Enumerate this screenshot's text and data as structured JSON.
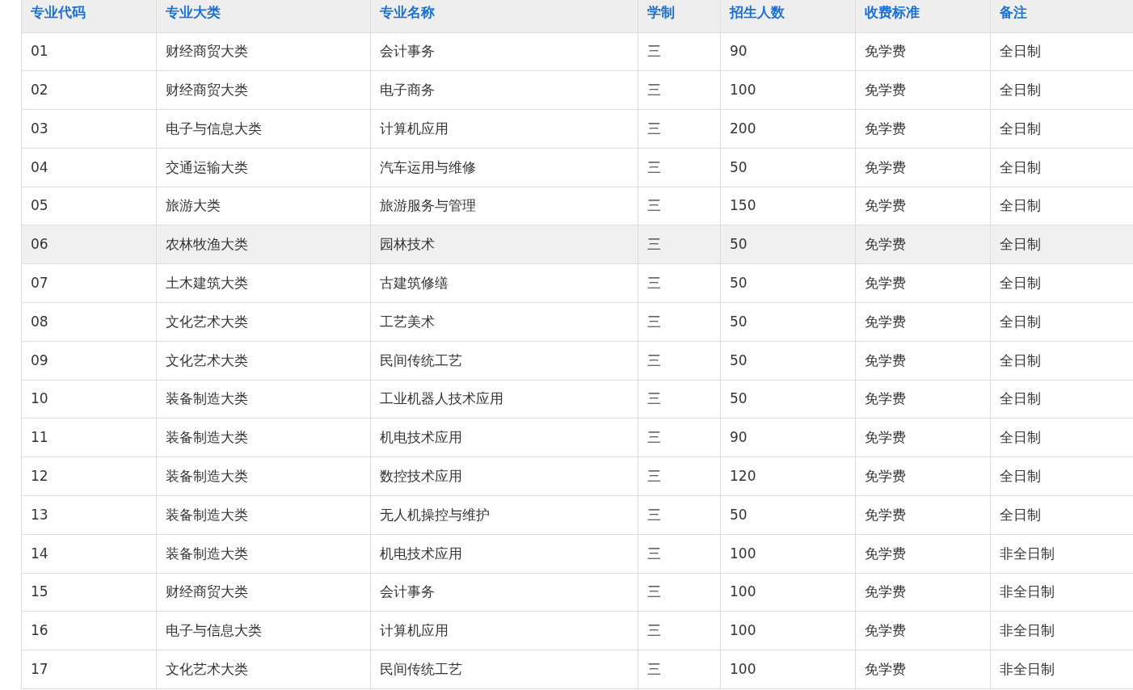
{
  "table": {
    "columns": [
      "专业代码",
      "专业大类",
      "专业名称",
      "学制",
      "招生人数",
      "收费标准",
      "备注"
    ],
    "rows": [
      {
        "cells": [
          "01",
          "财经商贸大类",
          "会计事务",
          "三",
          "90",
          "免学费",
          "全日制"
        ],
        "highlighted": false
      },
      {
        "cells": [
          "02",
          "财经商贸大类",
          "电子商务",
          "三",
          "100",
          "免学费",
          "全日制"
        ],
        "highlighted": false
      },
      {
        "cells": [
          "03",
          "电子与信息大类",
          "计算机应用",
          "三",
          "200",
          "免学费",
          "全日制"
        ],
        "highlighted": false
      },
      {
        "cells": [
          "04",
          "交通运输大类",
          "汽车运用与维修",
          "三",
          "50",
          "免学费",
          "全日制"
        ],
        "highlighted": false
      },
      {
        "cells": [
          "05",
          "旅游大类",
          "旅游服务与管理",
          "三",
          "150",
          "免学费",
          "全日制"
        ],
        "highlighted": false
      },
      {
        "cells": [
          "06",
          "农林牧渔大类",
          "园林技术",
          "三",
          "50",
          "免学费",
          "全日制"
        ],
        "highlighted": true
      },
      {
        "cells": [
          "07",
          "土木建筑大类",
          "古建筑修缮",
          "三",
          "50",
          "免学费",
          "全日制"
        ],
        "highlighted": false
      },
      {
        "cells": [
          "08",
          "文化艺术大类",
          "工艺美术",
          "三",
          "50",
          "免学费",
          "全日制"
        ],
        "highlighted": false
      },
      {
        "cells": [
          "09",
          "文化艺术大类",
          "民间传统工艺",
          "三",
          "50",
          "免学费",
          "全日制"
        ],
        "highlighted": false
      },
      {
        "cells": [
          "10",
          "装备制造大类",
          "工业机器人技术应用",
          "三",
          "50",
          "免学费",
          "全日制"
        ],
        "highlighted": false
      },
      {
        "cells": [
          "11",
          "装备制造大类",
          "机电技术应用",
          "三",
          "90",
          "免学费",
          "全日制"
        ],
        "highlighted": false
      },
      {
        "cells": [
          "12",
          "装备制造大类",
          "数控技术应用",
          "三",
          "120",
          "免学费",
          "全日制"
        ],
        "highlighted": false
      },
      {
        "cells": [
          "13",
          "装备制造大类",
          "无人机操控与维护",
          "三",
          "50",
          "免学费",
          "全日制"
        ],
        "highlighted": false
      },
      {
        "cells": [
          "14",
          "装备制造大类",
          "机电技术应用",
          "三",
          "100",
          "免学费",
          "非全日制"
        ],
        "highlighted": false
      },
      {
        "cells": [
          "15",
          "财经商贸大类",
          "会计事务",
          "三",
          "100",
          "免学费",
          "非全日制"
        ],
        "highlighted": false
      },
      {
        "cells": [
          "16",
          "电子与信息大类",
          "计算机应用",
          "三",
          "100",
          "免学费",
          "非全日制"
        ],
        "highlighted": false
      },
      {
        "cells": [
          "17",
          "文化艺术大类",
          "民间传统工艺",
          "三",
          "100",
          "免学费",
          "非全日制"
        ],
        "highlighted": false
      }
    ]
  }
}
